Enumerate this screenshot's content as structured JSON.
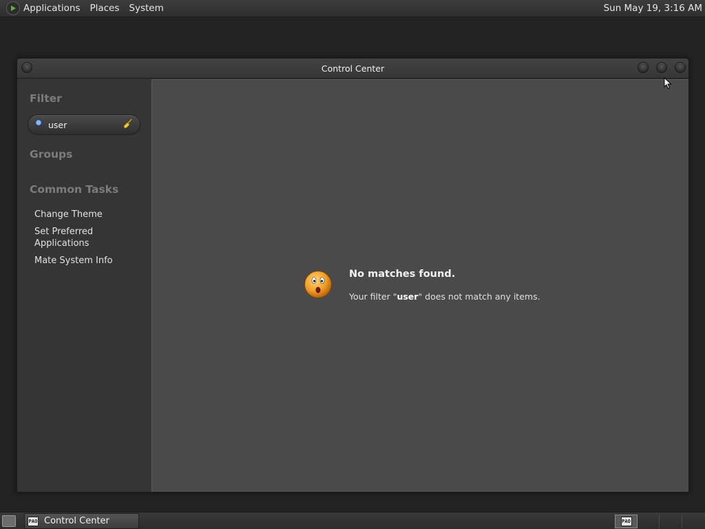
{
  "top_panel": {
    "menus": [
      "Applications",
      "Places",
      "System"
    ],
    "clock": "Sun May 19,  3:16 AM"
  },
  "window": {
    "title": "Control Center",
    "sidebar": {
      "filter_heading": "Filter",
      "search_value": "user",
      "groups_heading": "Groups",
      "tasks_heading": "Common Tasks",
      "tasks": [
        "Change Theme",
        "Set Preferred Applications",
        "Mate System Info"
      ]
    },
    "content": {
      "no_match_title": "No matches found.",
      "msg_prefix": "Your filter \"",
      "msg_term": "user",
      "msg_suffix": "\" does not match any items."
    }
  },
  "bottom_panel": {
    "task_label": "Control Center",
    "app_icon_text": "PAO"
  },
  "colors": {
    "content_bg": "#4a4a4a",
    "sidebar_bg": "#353535",
    "heading": "#7c7c7c",
    "face": "#f0a02a"
  }
}
